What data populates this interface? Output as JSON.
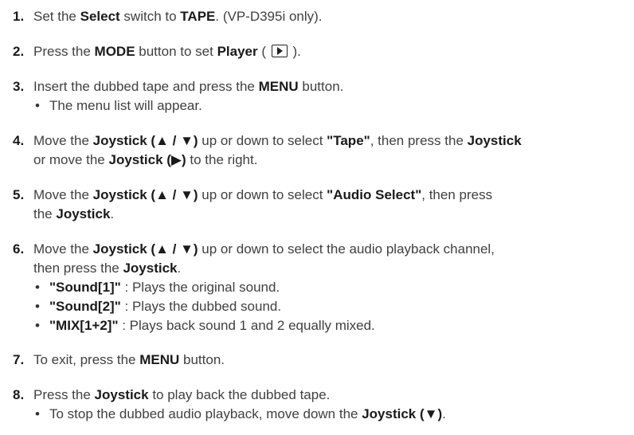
{
  "steps": [
    {
      "num": "1.",
      "line1": {
        "a": "Set the ",
        "b": "Select",
        "c": " switch to ",
        "d": "TAPE",
        "e": ". (VP-D395i only)."
      }
    },
    {
      "num": "2.",
      "line1": {
        "a": "Press the ",
        "b": "MODE",
        "c": " button to set ",
        "d": "Player",
        "e": " ( ",
        "icon": "play-mode-icon",
        "f": " )."
      }
    },
    {
      "num": "3.",
      "line1": {
        "a": "Insert the dubbed tape and press the ",
        "b": "MENU",
        "c": " button."
      },
      "bullets": [
        "The menu list will appear."
      ]
    },
    {
      "num": "4.",
      "line1": {
        "a": "Move the ",
        "b": "Joystick (▲ / ▼)",
        "c": " up or down to select ",
        "d": "\"Tape\"",
        "e": ", then press the ",
        "f": "Joystick"
      },
      "line2": {
        "a": "or move the ",
        "b": "Joystick (▶)",
        "c": " to the right."
      }
    },
    {
      "num": "5.",
      "line1": {
        "a": "Move the ",
        "b": "Joystick (▲ / ▼)",
        "c": " up or down to select ",
        "d": "\"Audio Select\"",
        "e": ", then press"
      },
      "line2": {
        "a": "the ",
        "b": "Joystick",
        "c": "."
      }
    },
    {
      "num": "6.",
      "line1": {
        "a": "Move the ",
        "b": "Joystick (▲ / ▼)",
        "c": " up or down to select the audio playback channel,"
      },
      "line2": {
        "a": "then press the ",
        "b": "Joystick",
        "c": "."
      },
      "options": [
        {
          "name": "\"Sound[1]\"",
          "desc": " : Plays the original sound."
        },
        {
          "name": "\"Sound[2]\"",
          "desc": " : Plays the dubbed sound."
        },
        {
          "name": "\"MIX[1+2]\"",
          "desc": " : Plays back sound 1 and 2 equally mixed."
        }
      ]
    },
    {
      "num": "7.",
      "line1": {
        "a": "To exit, press the ",
        "b": "MENU",
        "c": " button."
      }
    },
    {
      "num": "8.",
      "line1": {
        "a": "Press the ",
        "b": "Joystick",
        "c": " to play back the dubbed tape."
      },
      "bullet1": {
        "a": "To stop the dubbed audio playback, move down the ",
        "b": "Joystick (▼)",
        "c": "."
      }
    }
  ],
  "bullet_char": "•"
}
